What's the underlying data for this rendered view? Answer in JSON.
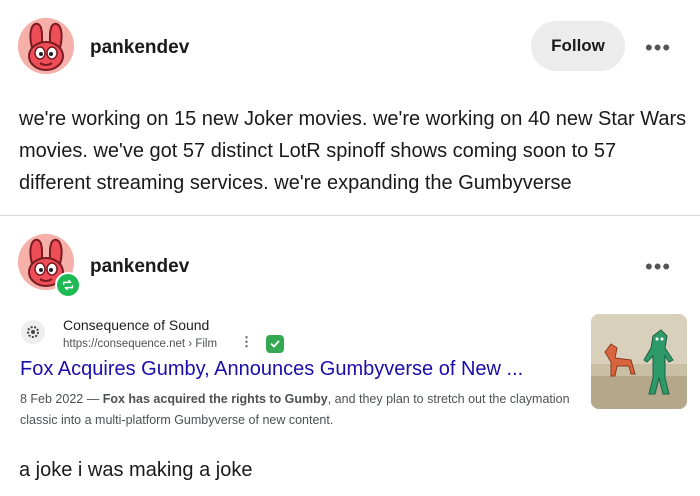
{
  "post": {
    "username": "pankendev",
    "follow_label": "Follow",
    "more_label": "•••",
    "text": "we're working on 15 new Joker movies. we're working on 40 new Star Wars movies. we've got 57 distinct LotR spinoff shows coming soon to 57 different streaming services. we're expanding the Gumbyverse"
  },
  "reblog": {
    "username": "pankendev",
    "more_label": "•••",
    "result": {
      "site_name": "Consequence of Sound",
      "site_url": "https://consequence.net › Film",
      "kebab": "⋮",
      "title": "Fox Acquires Gumby, Announces Gumbyverse of New ...",
      "date": "8 Feb 2022 — ",
      "bold": "Fox has acquired the rights to Gumby",
      "rest": ", and they plan to stretch out the claymation classic into a multi-platform Gumbyverse of new content."
    },
    "reply": "a joke i was making a joke"
  },
  "colors": {
    "link": "#1a0dab",
    "reblog_green": "#1db954",
    "follow_bg": "#ececec"
  }
}
